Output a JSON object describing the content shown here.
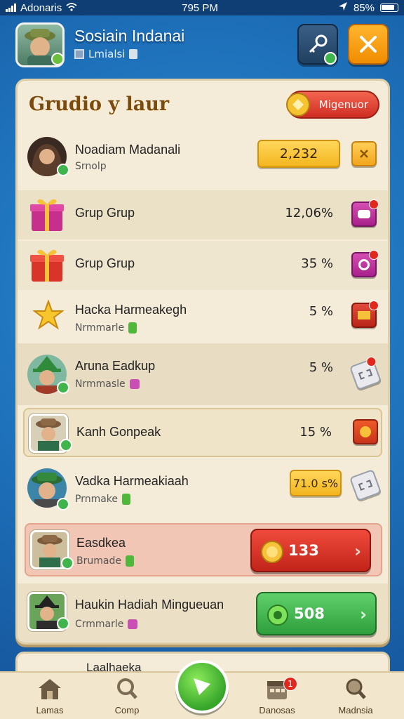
{
  "status": {
    "carrier": "Adonaris",
    "time": "795 PM",
    "battery": "85%"
  },
  "header": {
    "player_name": "Sosiain Indanai",
    "player_sub": "Lmialsi",
    "key_button_icon": "key-icon",
    "close_button_icon": "close-icon"
  },
  "panel": {
    "title": "Grudio y laur",
    "title_button": "Migenuor"
  },
  "rows": [
    {
      "name": "Noadiam Madanali",
      "sub": "Srnolp",
      "value": "2,232",
      "kind": "pill-gold",
      "action_icon": "close-icon"
    },
    {
      "name": "Grup Grup",
      "sub": "",
      "value": "12,06%",
      "kind": "gift",
      "action_icon": "mask-icon"
    },
    {
      "name": "Grup Grup",
      "sub": "",
      "value": "35 %",
      "kind": "gift",
      "action_icon": "swirl-icon"
    },
    {
      "name": "Hacka Harmeakegh",
      "sub": "Nrmmarle",
      "value": "5 %",
      "kind": "star",
      "action_icon": "mail-icon"
    },
    {
      "name": "Aruna Eadkup",
      "sub": "Nrmmasle",
      "value": "5 %",
      "kind": "avatar",
      "action_icon": "ticket-icon"
    },
    {
      "name": "Kanh Gonpeak",
      "sub": "",
      "value": "15 %",
      "kind": "avatar-sq",
      "action_icon": "gear-icon"
    },
    {
      "name": "Vadka Harmeakiaah",
      "sub": "Prnmake",
      "value": "71.0 s%",
      "kind": "pill-gold",
      "action_icon": "ticket-icon"
    },
    {
      "name": "Easdkea",
      "sub": "Brumade",
      "value": "133",
      "kind": "wide-red",
      "action_icon": "chevron-right-icon"
    },
    {
      "name": "Haukin Hadiah Mingueuan",
      "sub": "Crmmarle",
      "value": "508",
      "kind": "wide-green",
      "action_icon": "chevron-right-icon"
    }
  ],
  "peek_row": {
    "name": "Laalhaeka"
  },
  "nav": {
    "items": [
      {
        "label": "Lamas",
        "icon": "house-icon"
      },
      {
        "label": "Comp",
        "icon": "search-icon"
      },
      {
        "label": "Danosas",
        "icon": "calendar-icon",
        "badge": "1"
      },
      {
        "label": "Madnsia",
        "icon": "magnifier-icon"
      }
    ],
    "center_icon": "play-icon"
  },
  "colors": {
    "panel_bg": "#f4ecd9",
    "accent_gold": "#f2b51f",
    "accent_red": "#cf2d22",
    "accent_green": "#3fb54b",
    "bg_blue": "#1d6fb8"
  }
}
